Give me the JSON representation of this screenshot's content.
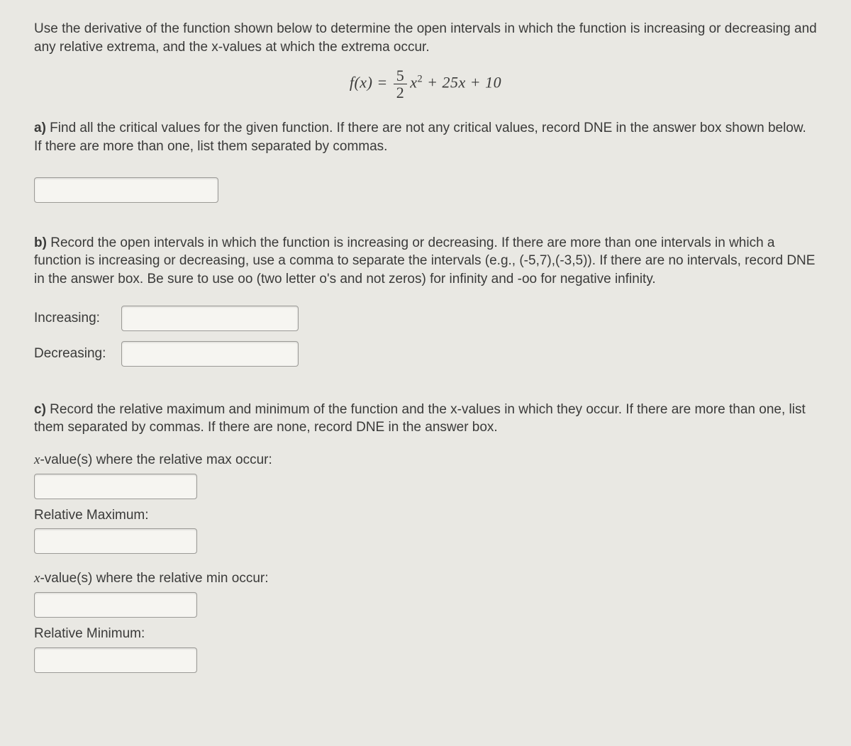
{
  "intro": "Use the derivative of the function shown below to determine the open intervals in which the function is increasing or decreasing and any relative extrema, and the x-values at which the extrema occur.",
  "equation": {
    "lhs": "f(x)",
    "equals": "=",
    "frac_top": "5",
    "frac_bot": "2",
    "x_var": "x",
    "sq": "2",
    "rest": " + 25x + 10"
  },
  "partA": {
    "letter": "a)",
    "text": " Find all the critical values for the given function. If there are not any critical values, record DNE in the answer box shown below. If there are more than one, list them separated by commas."
  },
  "partB": {
    "letter": "b)",
    "text": " Record the open intervals in which the function is increasing or decreasing. If there are more than one intervals in which a function is increasing or decreasing, use a comma to separate the intervals (e.g., (-5,7),(-3,5)). If there are no intervals, record DNE in the answer box. Be sure to use oo (two letter o's and not zeros) for infinity and -oo for negative infinity.",
    "labels": {
      "increasing": "Increasing:",
      "decreasing": "Decreasing:"
    }
  },
  "partC": {
    "letter": "c)",
    "text": " Record the relative maximum and minimum of the function and the x-values in which they occur. If there are more than one, list them separated by commas. If there are none, record DNE in the answer box.",
    "labels": {
      "xvar": "x",
      "max_x_suffix": "-value(s) where the relative max occur:",
      "rel_max": "Relative Maximum:",
      "min_x_suffix": "-value(s) where the relative min occur:",
      "rel_min": "Relative Minimum:"
    }
  }
}
